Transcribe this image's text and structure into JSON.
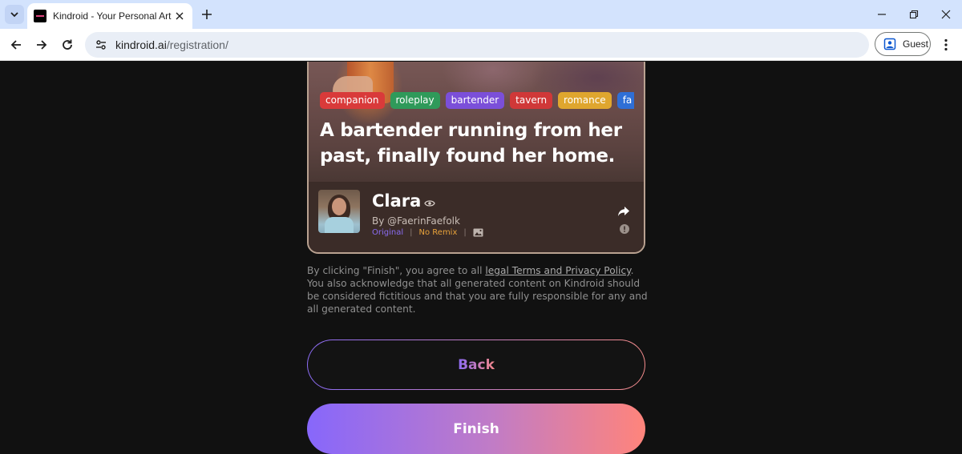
{
  "browser": {
    "tab": {
      "title": "Kindroid - Your Personal Artific"
    },
    "address": {
      "host": "kindroid.ai",
      "path": "/registration/"
    },
    "profile_label": "Guest"
  },
  "card": {
    "tags": [
      {
        "label": "companion",
        "color": "#d93a3a"
      },
      {
        "label": "roleplay",
        "color": "#2f9a5a"
      },
      {
        "label": "bartender",
        "color": "#7b4fd9"
      },
      {
        "label": "tavern",
        "color": "#d03838"
      },
      {
        "label": "romance",
        "color": "#dfa62e"
      },
      {
        "label": "fa",
        "color": "#2f6fd6"
      }
    ],
    "tagline": "A bartender running from her past, finally found her home.",
    "name": "Clara",
    "author": "By @FaerinFaefolk",
    "original_label": "Original",
    "remix_label": "No Remix",
    "original_color": "#8a6cf2",
    "remix_color": "#e8a23a"
  },
  "disclaimer": {
    "before_link": "By clicking \"Finish\", you agree to all ",
    "link_text": "legal Terms and Privacy Policy",
    "after_link": ". You also acknowledge that all generated content on Kindroid should be considered fictitious and that you are fully responsible for any and all generated content."
  },
  "buttons": {
    "back": "Back",
    "finish": "Finish"
  }
}
